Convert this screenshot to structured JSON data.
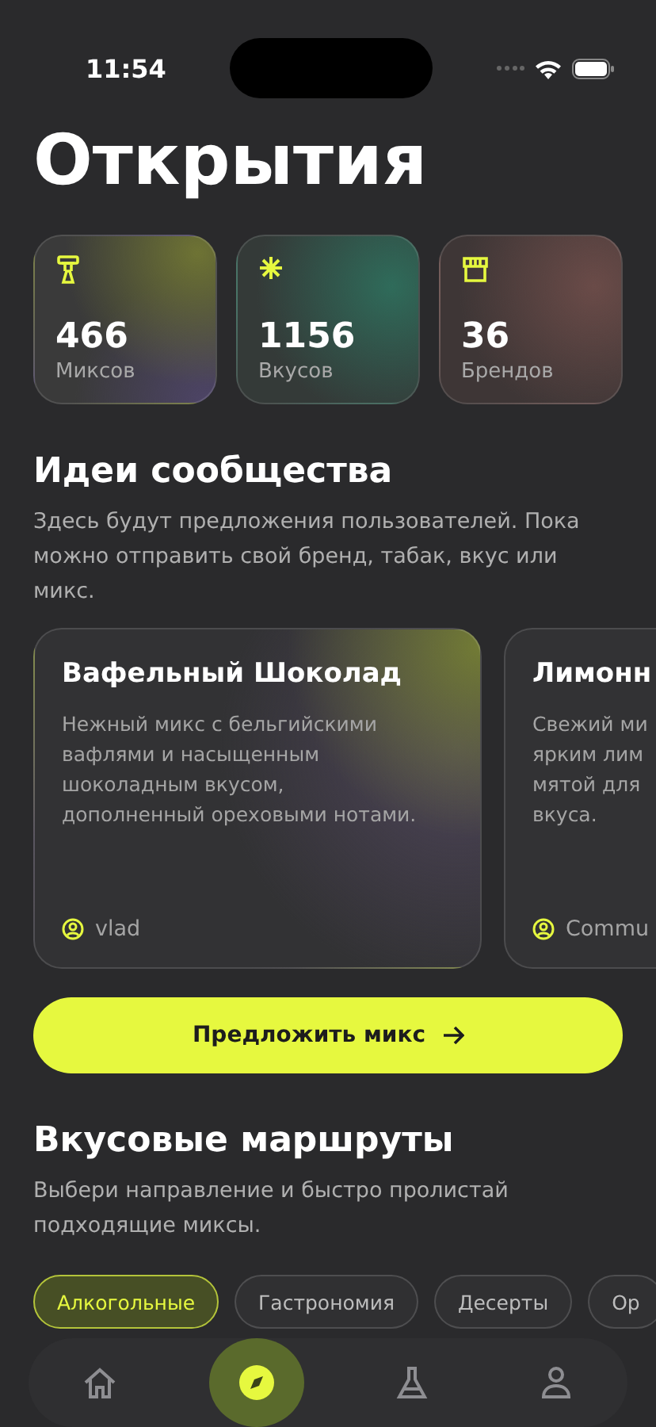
{
  "status_bar": {
    "time": "11:54"
  },
  "title": "Открытия",
  "stats": [
    {
      "kind": "mixes",
      "value": "466",
      "label": "Миксов"
    },
    {
      "kind": "flavors",
      "value": "1156",
      "label": "Вкусов"
    },
    {
      "kind": "brands",
      "value": "36",
      "label": "Брендов"
    }
  ],
  "community": {
    "title": "Идеи сообщества",
    "description": "Здесь будут предложения пользователей. Пока можно отправить свой бренд, табак, вкус или микс.",
    "cards": [
      {
        "title": "Вафельный Шоколад",
        "description_lines": [
          "Нежный микс с бельгийскими",
          "вафлями и насыщенным",
          "шоколадным вкусом,",
          "дополненный ореховыми нотами."
        ],
        "author": "vlad"
      },
      {
        "title": "Лимонн",
        "description_lines": [
          "Свежий ми",
          "ярким лим",
          "мятой для",
          "вкуса."
        ],
        "author": "Commu"
      }
    ],
    "button": "Предложить микс"
  },
  "routes": {
    "title": "Вкусовые маршруты",
    "description": "Выбери направление и быстро пролистай подходящие миксы.",
    "chips": [
      {
        "label": "Алкогольные",
        "selected": true
      },
      {
        "label": "Гастрономия",
        "selected": false
      },
      {
        "label": "Десерты",
        "selected": false
      },
      {
        "label": "Ор",
        "selected": false
      }
    ]
  },
  "tab_bar": [
    {
      "kind": "home",
      "selected": false
    },
    {
      "kind": "explore",
      "selected": true
    },
    {
      "kind": "lab",
      "selected": false
    },
    {
      "kind": "profile",
      "selected": false
    }
  ]
}
